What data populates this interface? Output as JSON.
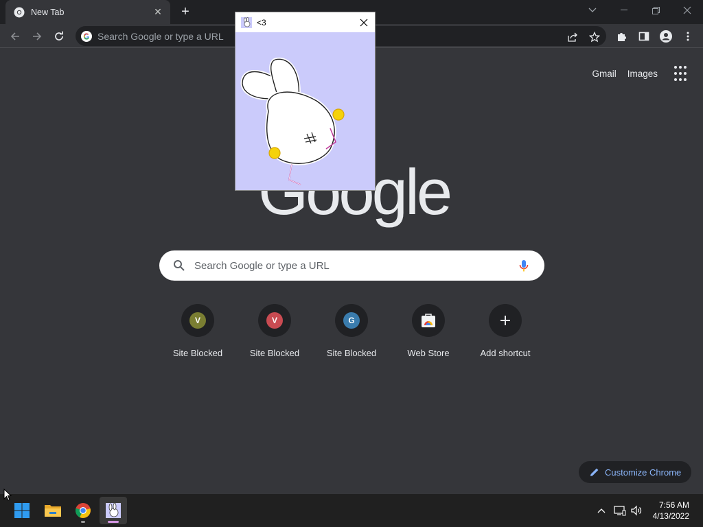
{
  "tab": {
    "title": "New Tab",
    "close_icon": "close-icon",
    "favicon": "chrome-icon"
  },
  "toolbar": {
    "omnibox_placeholder": "Search Google or type a URL"
  },
  "ntp": {
    "links": {
      "gmail": "Gmail",
      "images": "Images"
    },
    "logo": "Google",
    "search_placeholder": "Search Google or type a URL",
    "shortcuts": [
      {
        "label": "Site Blocked",
        "letter": "V",
        "color": "#7a7e32"
      },
      {
        "label": "Site Blocked",
        "letter": "V",
        "color": "#c94b52"
      },
      {
        "label": "Site Blocked",
        "letter": "G",
        "color": "#3a7cad"
      },
      {
        "label": "Web Store",
        "icon": "web-store-icon"
      },
      {
        "label": "Add shortcut",
        "icon": "plus-icon"
      }
    ],
    "customize_label": "Customize Chrome"
  },
  "popup": {
    "title": "<3",
    "bg_color": "#cbcbfb"
  },
  "taskbar": {
    "time": "7:56 AM",
    "date": "4/13/2022"
  },
  "colors": {
    "accent": "#8ab4f8",
    "frame": "#202124",
    "surface": "#35363a"
  }
}
